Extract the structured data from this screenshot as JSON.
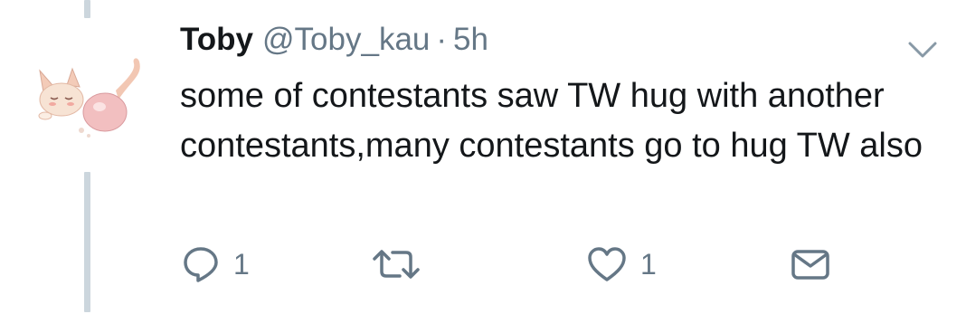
{
  "tweet": {
    "display_name": "Toby",
    "handle": "@Toby_kau",
    "separator": "·",
    "time": "5h",
    "text": "some of contestants saw TW hug with another contestants,many contestants go to hug TW also"
  },
  "actions": {
    "reply_count": "1",
    "like_count": "1"
  },
  "icons": {
    "menu": "chevron-down-icon",
    "reply": "speech-bubble-icon",
    "retweet": "retweet-icon",
    "like": "heart-icon",
    "dm": "envelope-icon"
  },
  "colors": {
    "text": "#14171a",
    "secondary": "#657786",
    "thread_line": "#ccd6dd"
  }
}
